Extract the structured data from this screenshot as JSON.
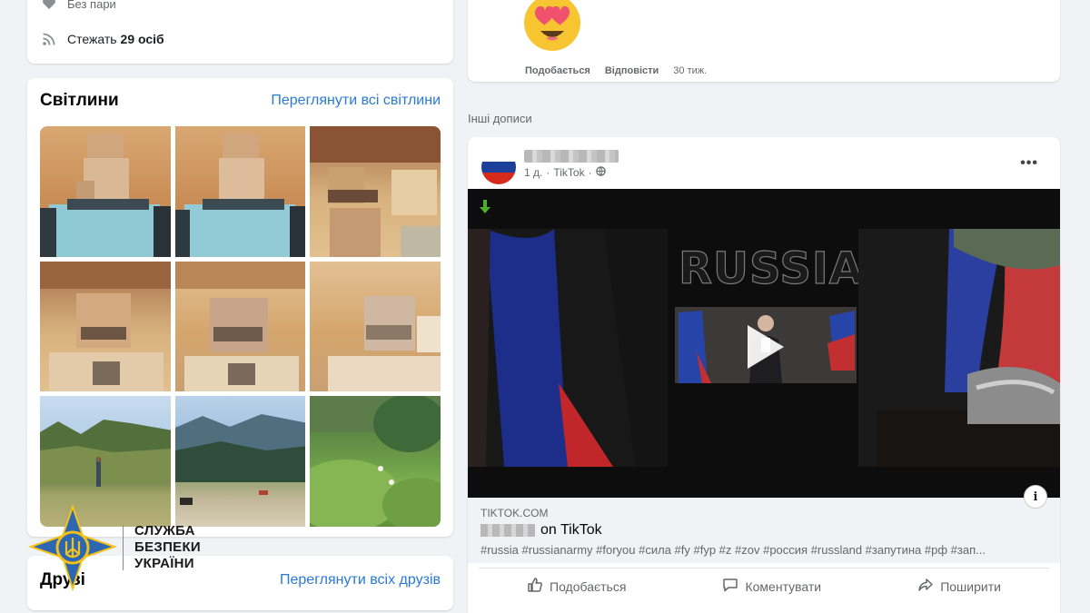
{
  "intro": {
    "relationship": "Без пари",
    "followers_prefix": "Стежать",
    "followers_count": "29 осіб"
  },
  "photos": {
    "title": "Світлини",
    "see_all": "Переглянути всі світлини"
  },
  "friends": {
    "title": "Друзі",
    "see_all": "Переглянути всіх друзів"
  },
  "logo": {
    "line1": "СЛУЖБА",
    "line2": "БЕЗПЕКИ",
    "line3": "УКРАЇНИ"
  },
  "prev_post": {
    "like": "Подобається",
    "reply": "Відповісти",
    "count": "30 тиж."
  },
  "section_label": "Інші дописи",
  "post": {
    "time": "1 д.",
    "source": "TikTok",
    "video_text": "RUSSIA",
    "link_domain": "TIKTOK.COM",
    "link_title_suffix": "on TikTok",
    "hashtags": "#russia #russianarmy #foryou #сила #fy #fyp #z #zov #россия #russland #запутина #рф #зап...",
    "actions": {
      "like": "Подобається",
      "comment": "Коментувати",
      "share": "Поширити"
    }
  },
  "colors": {
    "link": "#2a7ad4",
    "page_bg": "#f0f2f5",
    "card_bg": "#ffffff",
    "sbu_blue": "#2e67b1",
    "sbu_yellow": "#f2c21b"
  }
}
